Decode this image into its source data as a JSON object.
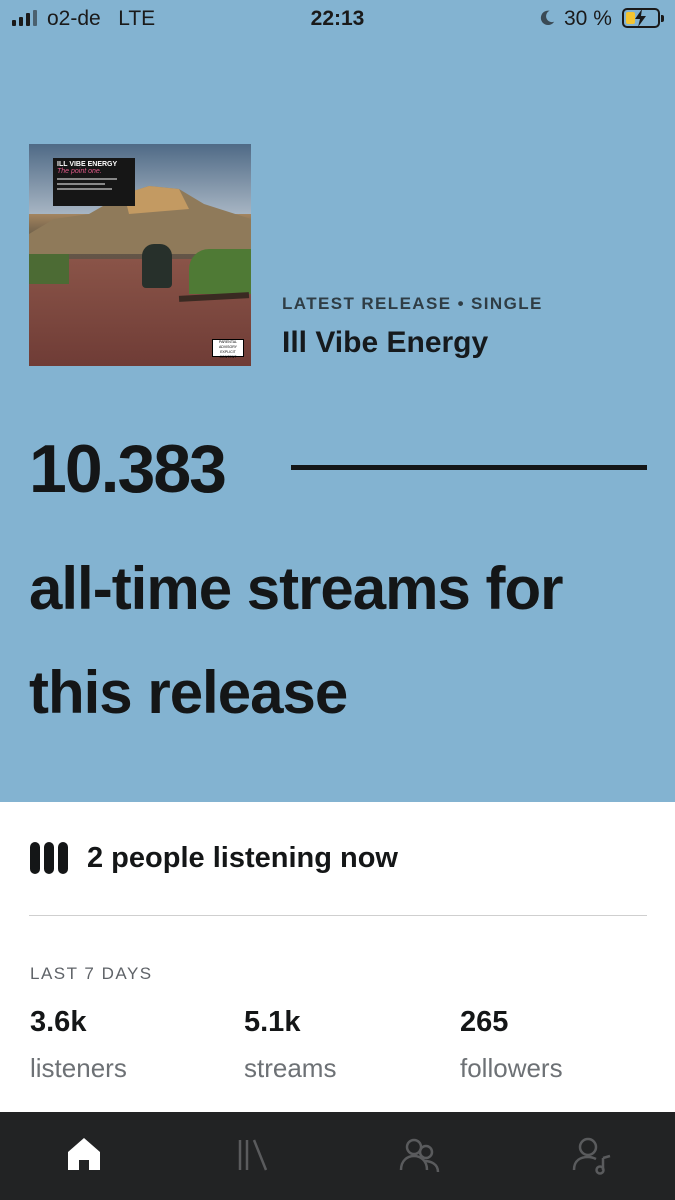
{
  "status_bar": {
    "carrier": "o2-de",
    "network": "LTE",
    "time": "22:13",
    "battery_percent": "30 %",
    "battery_fill": 0.3
  },
  "release": {
    "meta": "LATEST RELEASE • SINGLE",
    "title": "Ill Vibe Energy",
    "cover": {
      "title": "ILL VIBE ENERGY",
      "subtitle": "The point one.",
      "advisory": "PARENTAL ADVISORY EXPLICIT CONTENT"
    }
  },
  "streams": {
    "count": "10.383",
    "label": "all-time streams for this release"
  },
  "live": {
    "text": "2 people listening now"
  },
  "stats": {
    "period": "LAST 7 DAYS",
    "items": [
      {
        "value": "3.6k",
        "label": "listeners"
      },
      {
        "value": "5.1k",
        "label": "streams"
      },
      {
        "value": "265",
        "label": "followers"
      }
    ]
  },
  "tabs": [
    {
      "icon": "home-icon",
      "active": true
    },
    {
      "icon": "library-icon",
      "active": false
    },
    {
      "icon": "audience-icon",
      "active": false
    },
    {
      "icon": "profile-music-icon",
      "active": false
    }
  ],
  "colors": {
    "hero_bg": "#83b3d1",
    "text_dark": "#141617",
    "tabbar_bg": "#222324",
    "tab_active": "#ffffff",
    "tab_inactive": "#5a5b5d"
  }
}
